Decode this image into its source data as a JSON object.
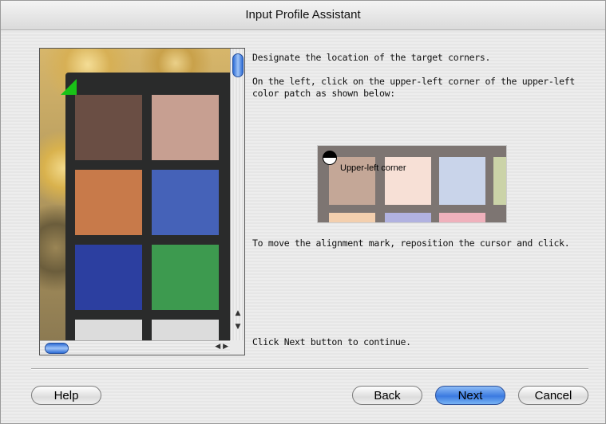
{
  "window": {
    "title": "Input Profile Assistant"
  },
  "instructions": {
    "line1": "Designate the location of the target corners.",
    "line2": "On the left, click on the upper-left corner of the upper-left color patch as shown below:",
    "line3": "To move the alignment mark, reposition the cursor and click.",
    "line4": "Click Next button to continue."
  },
  "sample": {
    "label": "Upper-left corner"
  },
  "buttons": {
    "help": "Help",
    "back": "Back",
    "next": "Next",
    "cancel": "Cancel"
  },
  "colors": {
    "patches": [
      "#6a4e44",
      "#c79f91",
      "#c87a4a",
      "#4562b8",
      "#2c3fa0",
      "#3d9a4f",
      "#dcdcdc",
      "#dcdcdc"
    ],
    "sample_patches": [
      "#c4a797",
      "#f7e0d6",
      "#c9d4ea",
      "#cbd3a8"
    ],
    "alignment_mark": "#19c217",
    "accent": "#3b7ae0"
  }
}
